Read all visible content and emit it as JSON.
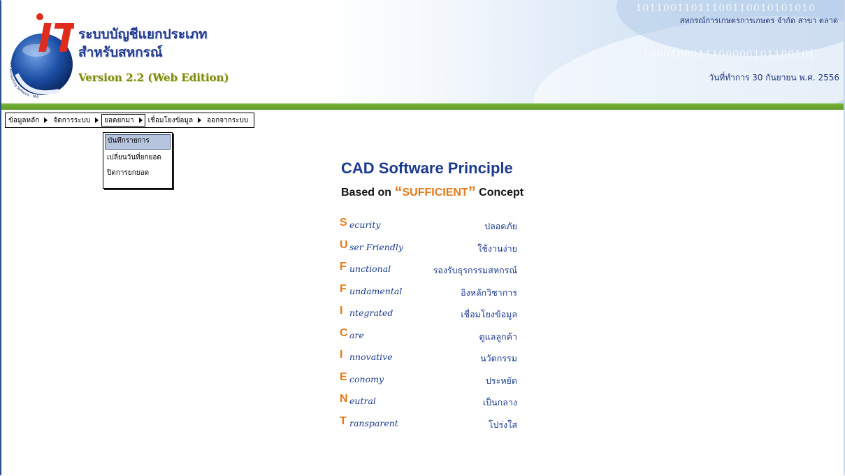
{
  "header": {
    "app_title_line1": "ระบบบัญชีแยกประเภท",
    "app_title_line2": "สำหรับสหกรณ์",
    "version": "Version 2.2 (Web Edition)",
    "coop_name": "สหกรณ์การเกษตรการเกษตร จำกัด สาขา ตลาด",
    "work_date": "วันที่ทำการ 30 กันยายน พ.ศ. 2556",
    "logo_letters": "IT",
    "logo_ring_text": "Full Pack Accounting Software : FAS",
    "binary_line1": "10110011011100110010101010",
    "binary_line2": "1000100011100000101100101"
  },
  "menu": {
    "items": [
      {
        "label": "ข้อมูลหลัก",
        "active": false
      },
      {
        "label": "จัดการระบบ",
        "active": false
      },
      {
        "label": "ยอดยกมา",
        "active": true
      },
      {
        "label": "เชื่อมโยงข้อมูล",
        "active": false
      },
      {
        "label": "ออกจากระบบ",
        "active": false
      }
    ],
    "submenu": [
      {
        "label": "บันทึกรายการ",
        "hover": true
      },
      {
        "label": "เปลี่ยนวันที่ยกยอด",
        "hover": false
      },
      {
        "label": "ปิดการยกยอด",
        "hover": false
      }
    ]
  },
  "principle": {
    "title_prefix": "CAD",
    "title_rest": " Software Principle",
    "subtitle_pre": "Based on ",
    "subtitle_open_quote": "“",
    "subtitle_highlight": "SUFFICIENT",
    "subtitle_close_quote": "”",
    "subtitle_post": " Concept",
    "rows": [
      {
        "letter": "S",
        "rest": "ecurity",
        "thai": "ปลอดภัย"
      },
      {
        "letter": "U",
        "rest": "ser Friendly",
        "thai": "ใช้งานง่าย"
      },
      {
        "letter": "F",
        "rest": "unctional",
        "thai": "รองรับธุรกรรมสหกรณ์"
      },
      {
        "letter": "F",
        "rest": "undamental",
        "thai": "อิงหลักวิชาการ"
      },
      {
        "letter": "I",
        "rest": "ntegrated",
        "thai": "เชื่อมโยงข้อมูล"
      },
      {
        "letter": "C",
        "rest": "are",
        "thai": "ดูแลลูกค้า"
      },
      {
        "letter": "I",
        "rest": "nnovative",
        "thai": "นวัตกรรม"
      },
      {
        "letter": "E",
        "rest": "conomy",
        "thai": "ประหยัด"
      },
      {
        "letter": "N",
        "rest": "eutral",
        "thai": "เป็นกลาง"
      },
      {
        "letter": "T",
        "rest": "ransparent",
        "thai": "โปร่งใส"
      }
    ]
  },
  "colors": {
    "brand_blue": "#1c3b8e",
    "accent_orange": "#e57a1a",
    "green_bar": "#6aa82f",
    "menu_hover": "#b7c4de"
  }
}
